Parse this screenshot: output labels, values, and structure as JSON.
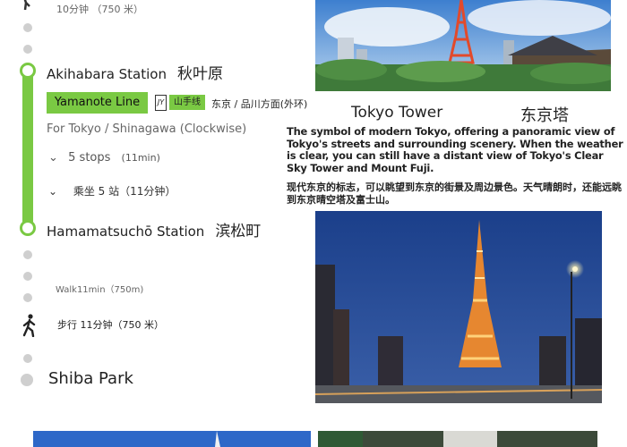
{
  "route": {
    "walk_top": "10分钟 （750 米）",
    "station1": {
      "name_en": "Akihabara Station",
      "name_cn": "秋叶原"
    },
    "line": {
      "name": "Yamanote Line",
      "jy_mark": "JY",
      "name_cn": "山手线",
      "direction_cn": "东京 / 品川方面(外环)"
    },
    "direction_en": "For Tokyo / Shinagawa (Clockwise)",
    "stops_en": "5 stops",
    "stops_time": "(11min)",
    "stops_cn": "乘坐 5 站（11分钟）",
    "station2": {
      "name_en": "Hamamatsuchō Station",
      "name_cn": "滨松町"
    },
    "walk_en": "Walk11min（750m)",
    "walk_cn": "步行 11分钟（750 米）",
    "destination": "Shiba Park"
  },
  "attraction": {
    "title_en": "Tokyo Tower",
    "title_cn": "东京塔",
    "desc_en": "The symbol of modern Tokyo, offering a panoramic view of Tokyo's streets and surrounding scenery. When the weather is clear, you can still have a distant view of Tokyo's Clear Sky Tower and Mount Fuji.",
    "desc_cn": "现代东京的标志，可以眺望到东京的街景及周边景色。天气晴朗时，还能远眺到东京晴空塔及富士山。"
  },
  "icons": {
    "walk": "walking-person-icon",
    "chevron": "chevron-down-icon"
  },
  "colors": {
    "line_green": "#7ac943",
    "dot_gray": "#cfcfcf"
  }
}
